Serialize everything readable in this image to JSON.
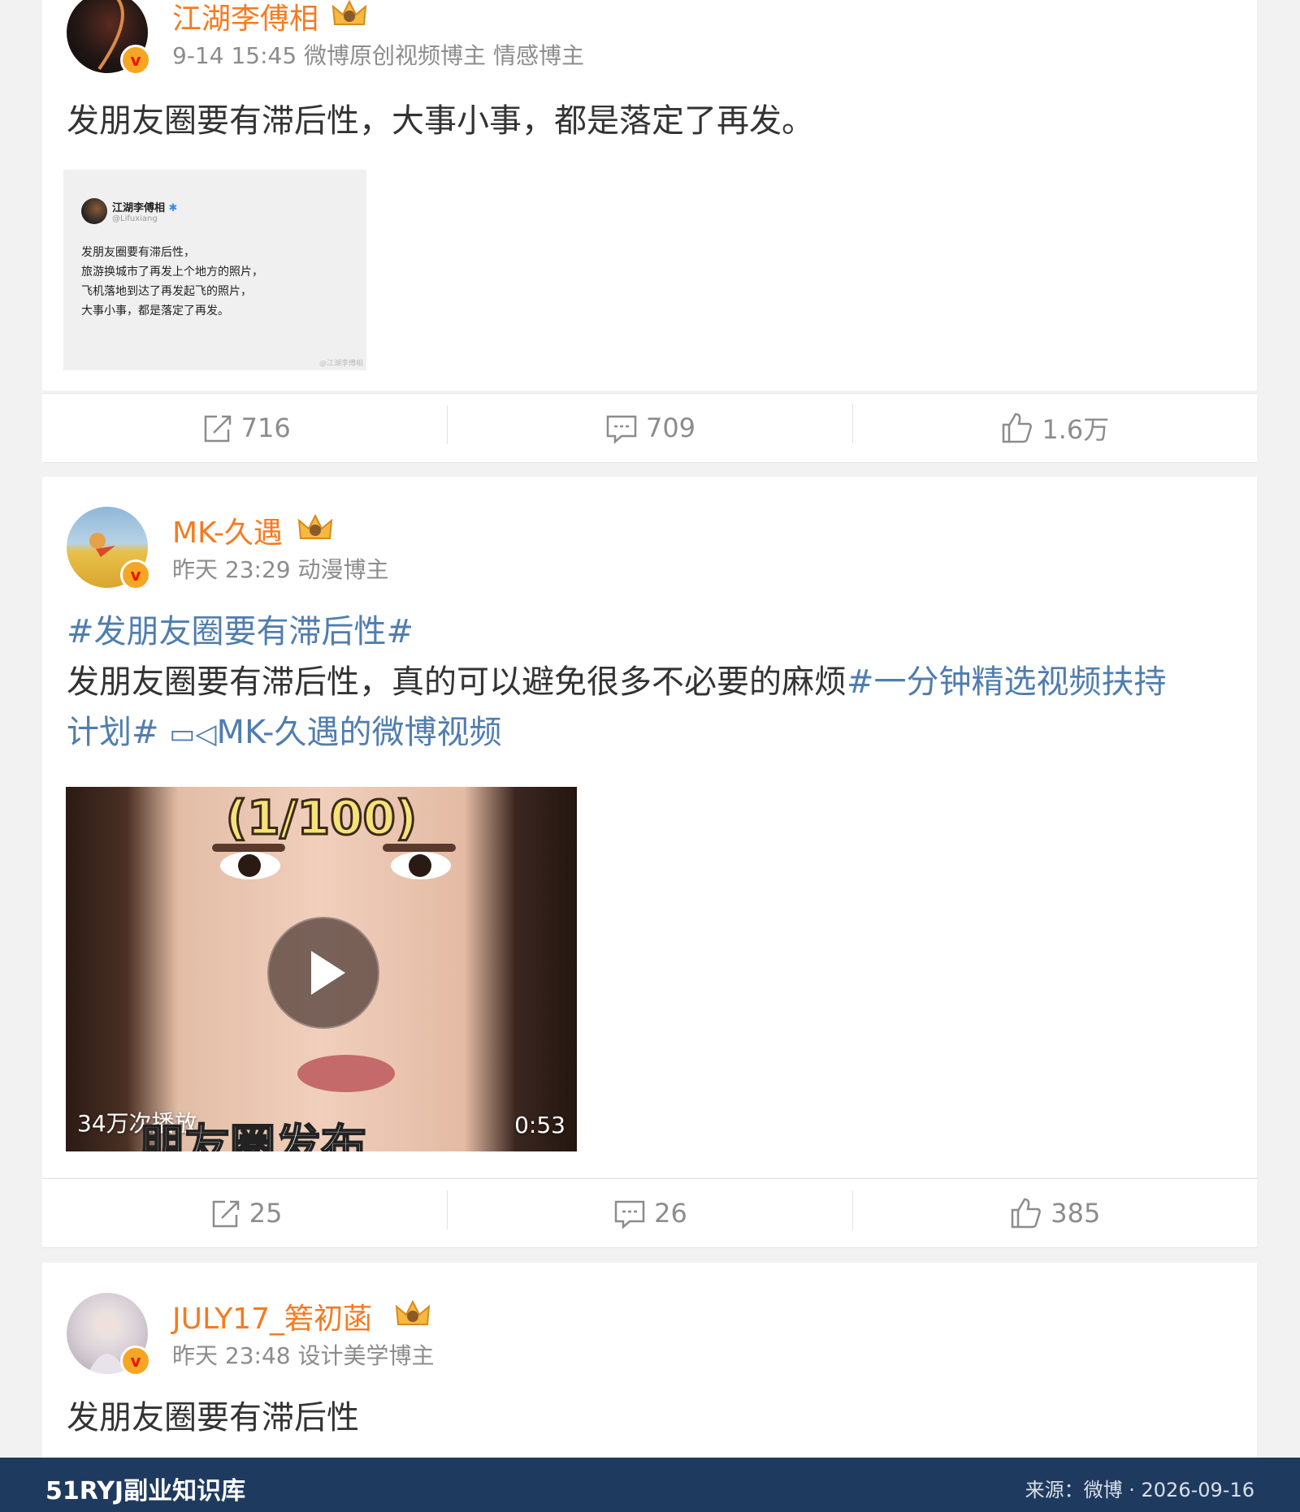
{
  "posts": [
    {
      "username": "江湖李傅相",
      "meta": "9-14 15:45 微博原创视频博主 情感博主",
      "text": "发朋友圈要有滞后性，大事小事，都是落定了再发。",
      "image": {
        "name": "江湖李傅相",
        "handle": "@Lifuxiang",
        "lines": [
          "发朋友圈要有滞后性，",
          "旅游换城市了再发上个地方的照片，",
          "飞机落地到达了再发起飞的照片，",
          "大事小事，都是落定了再发。"
        ],
        "watermark": "@江湖李傅相"
      },
      "actions": {
        "repost": "716",
        "comment": "709",
        "like": "1.6万"
      }
    },
    {
      "username": "MK-久遇",
      "meta": "昨天 23:29 动漫博主",
      "hashtag": "#发朋友圈要有滞后性#",
      "text_main": "发朋友圈要有滞后性，真的可以避免很多不必要的麻烦",
      "hashtag2_a": "#一分钟精选视频扶持",
      "hashtag2_b": "计划#",
      "video_link": "MK-久遇的微博视频",
      "video": {
        "title": "(1/100)",
        "subtitle": "朋友圈发布",
        "plays": "34万次播放",
        "duration": "0:53"
      },
      "actions": {
        "repost": "25",
        "comment": "26",
        "like": "385"
      }
    },
    {
      "username": "JULY17_箬初菡",
      "meta": "昨天 23:48 设计美学博主",
      "text": "发朋友圈要有滞后性"
    }
  ],
  "footer": {
    "brand": "51RYJ副业知识库",
    "source": "来源：微博 · 2026-09-16"
  },
  "colors": {
    "username": "#f57b20",
    "link": "#507daf",
    "footer_bg": "#1f3a5f"
  }
}
